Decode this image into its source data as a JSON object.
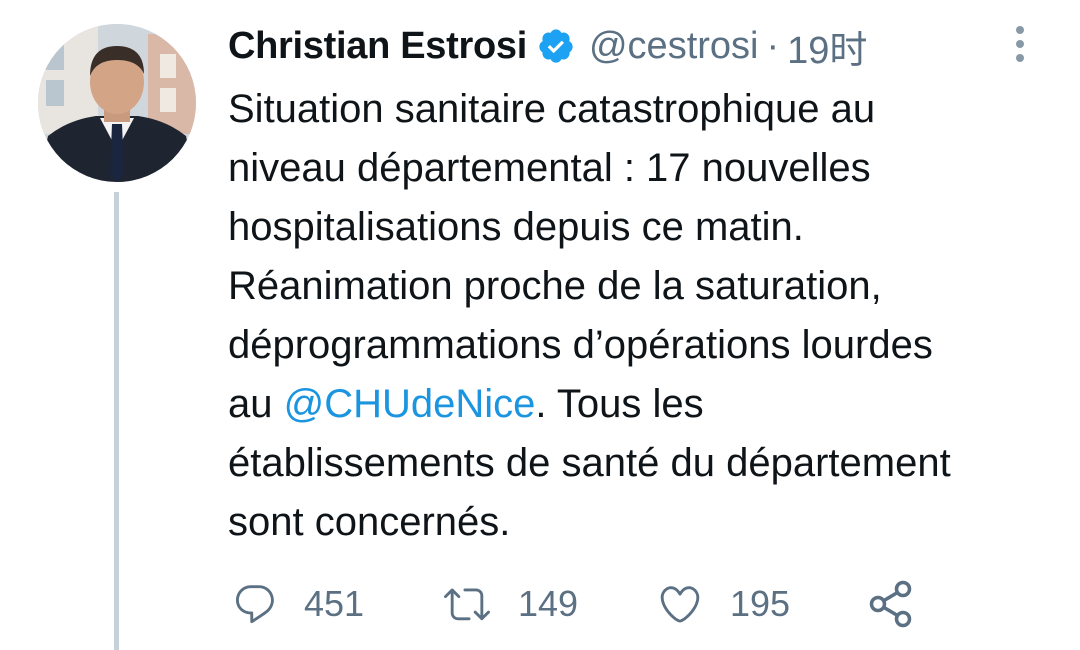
{
  "author": {
    "display_name": "Christian Estrosi",
    "handle": "@cestrosi",
    "separator": "·",
    "time": "19时"
  },
  "tweet": {
    "lines": [
      "Situation sanitaire catastrophique au",
      "niveau départemental : 17 nouvelles",
      "hospitalisations depuis ce matin.",
      "Réanimation proche de la saturation,",
      "déprogrammations d’opérations lourdes"
    ],
    "line6_prefix": "au ",
    "mention": "@CHUdeNice",
    "line6_suffix": ". Tous les",
    "line7": "établissements de santé du département",
    "line8": "sont concernés."
  },
  "actions": {
    "replies": "451",
    "retweets": "149",
    "likes": "195"
  },
  "colors": {
    "text": "#0f1419",
    "secondary": "#5b7083",
    "link": "#1b95e0",
    "verified": "#1da1f2",
    "thread_line": "#c9d1d8"
  },
  "icons": {
    "verified": "verified-badge-icon",
    "more": "more-vertical-icon",
    "reply": "reply-icon",
    "retweet": "retweet-icon",
    "like": "heart-icon",
    "share": "share-icon"
  }
}
